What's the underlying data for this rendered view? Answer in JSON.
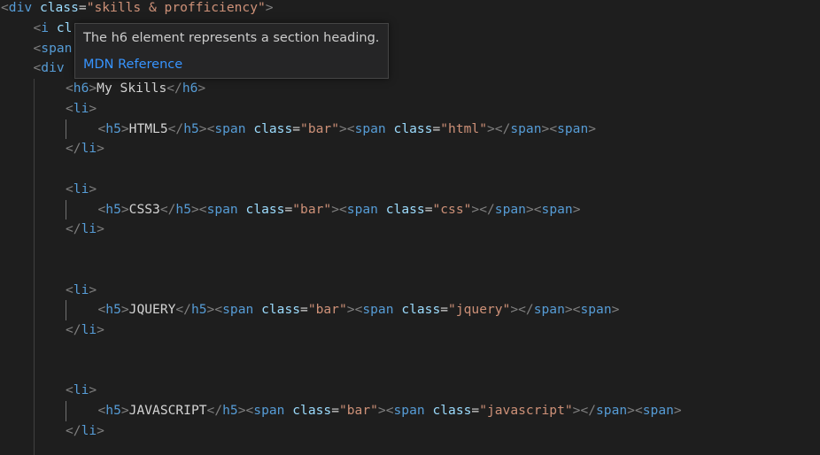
{
  "editor": {
    "lines": [
      {
        "indent": 0,
        "tokens": [
          {
            "t": "<",
            "c": "punct"
          },
          {
            "t": "div",
            "c": "tag"
          },
          {
            "t": " ",
            "c": "txt"
          },
          {
            "t": "class",
            "c": "attr"
          },
          {
            "t": "=",
            "c": "txt"
          },
          {
            "t": "\"skills & profficiency\"",
            "c": "str"
          },
          {
            "t": ">",
            "c": "punct"
          }
        ]
      },
      {
        "indent": 1,
        "tokens": [
          {
            "t": "<",
            "c": "punct"
          },
          {
            "t": "i",
            "c": "tag"
          },
          {
            "t": " ",
            "c": "txt"
          },
          {
            "t": "cl",
            "c": "attr"
          }
        ]
      },
      {
        "indent": 1,
        "tokens": [
          {
            "t": "<",
            "c": "punct"
          },
          {
            "t": "span",
            "c": "tag"
          }
        ]
      },
      {
        "indent": 1,
        "tokens": [
          {
            "t": "<",
            "c": "punct"
          },
          {
            "t": "div",
            "c": "tag"
          }
        ]
      },
      {
        "indent": 2,
        "tokens": [
          {
            "t": "<",
            "c": "punct"
          },
          {
            "t": "h6",
            "c": "tag"
          },
          {
            "t": ">",
            "c": "punct"
          },
          {
            "t": "My Skills",
            "c": "txt"
          },
          {
            "t": "</",
            "c": "punct"
          },
          {
            "t": "h6",
            "c": "tag"
          },
          {
            "t": ">",
            "c": "punct"
          }
        ]
      },
      {
        "indent": 2,
        "tokens": [
          {
            "t": "<",
            "c": "punct"
          },
          {
            "t": "li",
            "c": "tag"
          },
          {
            "t": ">",
            "c": "punct"
          }
        ]
      },
      {
        "indent": 3,
        "tokens": [
          {
            "t": "<",
            "c": "punct"
          },
          {
            "t": "h5",
            "c": "tag"
          },
          {
            "t": ">",
            "c": "punct"
          },
          {
            "t": "HTML5",
            "c": "txt"
          },
          {
            "t": "</",
            "c": "punct"
          },
          {
            "t": "h5",
            "c": "tag"
          },
          {
            "t": ">",
            "c": "punct"
          },
          {
            "t": "<",
            "c": "punct"
          },
          {
            "t": "span",
            "c": "tag"
          },
          {
            "t": " ",
            "c": "txt"
          },
          {
            "t": "class",
            "c": "attr"
          },
          {
            "t": "=",
            "c": "txt"
          },
          {
            "t": "\"bar\"",
            "c": "str"
          },
          {
            "t": ">",
            "c": "punct"
          },
          {
            "t": "<",
            "c": "punct"
          },
          {
            "t": "span",
            "c": "tag"
          },
          {
            "t": " ",
            "c": "txt"
          },
          {
            "t": "class",
            "c": "attr"
          },
          {
            "t": "=",
            "c": "txt"
          },
          {
            "t": "\"html\"",
            "c": "str"
          },
          {
            "t": ">",
            "c": "punct"
          },
          {
            "t": "</",
            "c": "punct"
          },
          {
            "t": "span",
            "c": "tag"
          },
          {
            "t": ">",
            "c": "punct"
          },
          {
            "t": "<",
            "c": "punct"
          },
          {
            "t": "span",
            "c": "tag"
          },
          {
            "t": ">",
            "c": "punct"
          }
        ]
      },
      {
        "indent": 2,
        "tokens": [
          {
            "t": "</",
            "c": "punct"
          },
          {
            "t": "li",
            "c": "tag"
          },
          {
            "t": ">",
            "c": "punct"
          }
        ]
      },
      {
        "indent": 2,
        "tokens": []
      },
      {
        "indent": 2,
        "tokens": [
          {
            "t": "<",
            "c": "punct"
          },
          {
            "t": "li",
            "c": "tag"
          },
          {
            "t": ">",
            "c": "punct"
          }
        ]
      },
      {
        "indent": 3,
        "tokens": [
          {
            "t": "<",
            "c": "punct"
          },
          {
            "t": "h5",
            "c": "tag"
          },
          {
            "t": ">",
            "c": "punct"
          },
          {
            "t": "CSS3",
            "c": "txt"
          },
          {
            "t": "</",
            "c": "punct"
          },
          {
            "t": "h5",
            "c": "tag"
          },
          {
            "t": ">",
            "c": "punct"
          },
          {
            "t": "<",
            "c": "punct"
          },
          {
            "t": "span",
            "c": "tag"
          },
          {
            "t": " ",
            "c": "txt"
          },
          {
            "t": "class",
            "c": "attr"
          },
          {
            "t": "=",
            "c": "txt"
          },
          {
            "t": "\"bar\"",
            "c": "str"
          },
          {
            "t": ">",
            "c": "punct"
          },
          {
            "t": "<",
            "c": "punct"
          },
          {
            "t": "span",
            "c": "tag"
          },
          {
            "t": " ",
            "c": "txt"
          },
          {
            "t": "class",
            "c": "attr"
          },
          {
            "t": "=",
            "c": "txt"
          },
          {
            "t": "\"css\"",
            "c": "str"
          },
          {
            "t": ">",
            "c": "punct"
          },
          {
            "t": "</",
            "c": "punct"
          },
          {
            "t": "span",
            "c": "tag"
          },
          {
            "t": ">",
            "c": "punct"
          },
          {
            "t": "<",
            "c": "punct"
          },
          {
            "t": "span",
            "c": "tag"
          },
          {
            "t": ">",
            "c": "punct"
          }
        ]
      },
      {
        "indent": 2,
        "tokens": [
          {
            "t": "</",
            "c": "punct"
          },
          {
            "t": "li",
            "c": "tag"
          },
          {
            "t": ">",
            "c": "punct"
          }
        ]
      },
      {
        "indent": 2,
        "tokens": []
      },
      {
        "indent": 2,
        "tokens": []
      },
      {
        "indent": 2,
        "tokens": [
          {
            "t": "<",
            "c": "punct"
          },
          {
            "t": "li",
            "c": "tag"
          },
          {
            "t": ">",
            "c": "punct"
          }
        ]
      },
      {
        "indent": 3,
        "tokens": [
          {
            "t": "<",
            "c": "punct"
          },
          {
            "t": "h5",
            "c": "tag"
          },
          {
            "t": ">",
            "c": "punct"
          },
          {
            "t": "JQUERY",
            "c": "txt"
          },
          {
            "t": "</",
            "c": "punct"
          },
          {
            "t": "h5",
            "c": "tag"
          },
          {
            "t": ">",
            "c": "punct"
          },
          {
            "t": "<",
            "c": "punct"
          },
          {
            "t": "span",
            "c": "tag"
          },
          {
            "t": " ",
            "c": "txt"
          },
          {
            "t": "class",
            "c": "attr"
          },
          {
            "t": "=",
            "c": "txt"
          },
          {
            "t": "\"bar\"",
            "c": "str"
          },
          {
            "t": ">",
            "c": "punct"
          },
          {
            "t": "<",
            "c": "punct"
          },
          {
            "t": "span",
            "c": "tag"
          },
          {
            "t": " ",
            "c": "txt"
          },
          {
            "t": "class",
            "c": "attr"
          },
          {
            "t": "=",
            "c": "txt"
          },
          {
            "t": "\"jquery\"",
            "c": "str"
          },
          {
            "t": ">",
            "c": "punct"
          },
          {
            "t": "</",
            "c": "punct"
          },
          {
            "t": "span",
            "c": "tag"
          },
          {
            "t": ">",
            "c": "punct"
          },
          {
            "t": "<",
            "c": "punct"
          },
          {
            "t": "span",
            "c": "tag"
          },
          {
            "t": ">",
            "c": "punct"
          }
        ]
      },
      {
        "indent": 2,
        "tokens": [
          {
            "t": "</",
            "c": "punct"
          },
          {
            "t": "li",
            "c": "tag"
          },
          {
            "t": ">",
            "c": "punct"
          }
        ]
      },
      {
        "indent": 2,
        "tokens": []
      },
      {
        "indent": 2,
        "tokens": []
      },
      {
        "indent": 2,
        "tokens": [
          {
            "t": "<",
            "c": "punct"
          },
          {
            "t": "li",
            "c": "tag"
          },
          {
            "t": ">",
            "c": "punct"
          }
        ]
      },
      {
        "indent": 3,
        "tokens": [
          {
            "t": "<",
            "c": "punct"
          },
          {
            "t": "h5",
            "c": "tag"
          },
          {
            "t": ">",
            "c": "punct"
          },
          {
            "t": "JAVASCRIPT",
            "c": "txt"
          },
          {
            "t": "</",
            "c": "punct"
          },
          {
            "t": "h5",
            "c": "tag"
          },
          {
            "t": ">",
            "c": "punct"
          },
          {
            "t": "<",
            "c": "punct"
          },
          {
            "t": "span",
            "c": "tag"
          },
          {
            "t": " ",
            "c": "txt"
          },
          {
            "t": "class",
            "c": "attr"
          },
          {
            "t": "=",
            "c": "txt"
          },
          {
            "t": "\"bar\"",
            "c": "str"
          },
          {
            "t": ">",
            "c": "punct"
          },
          {
            "t": "<",
            "c": "punct"
          },
          {
            "t": "span",
            "c": "tag"
          },
          {
            "t": " ",
            "c": "txt"
          },
          {
            "t": "class",
            "c": "attr"
          },
          {
            "t": "=",
            "c": "txt"
          },
          {
            "t": "\"javascript\"",
            "c": "str"
          },
          {
            "t": ">",
            "c": "punct"
          },
          {
            "t": "</",
            "c": "punct"
          },
          {
            "t": "span",
            "c": "tag"
          },
          {
            "t": ">",
            "c": "punct"
          },
          {
            "t": "<",
            "c": "punct"
          },
          {
            "t": "span",
            "c": "tag"
          },
          {
            "t": ">",
            "c": "punct"
          }
        ]
      },
      {
        "indent": 2,
        "tokens": [
          {
            "t": "</",
            "c": "punct"
          },
          {
            "t": "li",
            "c": "tag"
          },
          {
            "t": ">",
            "c": "punct"
          }
        ]
      },
      {
        "indent": 2,
        "tokens": []
      }
    ]
  },
  "hover": {
    "description": "The h6 element represents a section heading.",
    "link_label": "MDN Reference"
  },
  "colors": {
    "background": "#1e1e1e",
    "tag": "#569cd6",
    "attribute": "#9cdcfe",
    "string": "#ce9178",
    "punctuation": "#808080",
    "text": "#d4d4d4",
    "link": "#3794ff",
    "hover_background": "#252526"
  }
}
